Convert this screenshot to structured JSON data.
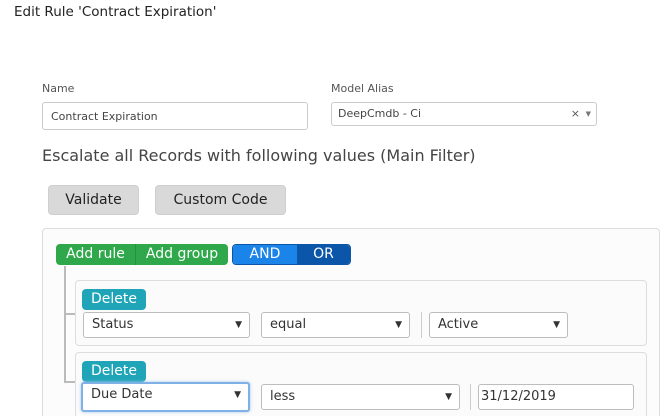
{
  "page": {
    "title": "Edit Rule 'Contract Expiration'"
  },
  "form": {
    "name_label": "Name",
    "name_value": "Contract Expiration",
    "alias_label": "Model Alias",
    "alias_value": "DeepCmdb - Ci",
    "alias_clear": "×",
    "alias_caret": "▼"
  },
  "filter": {
    "heading": "Escalate all Records with following values (Main Filter)",
    "validate_label": "Validate",
    "custom_code_label": "Custom Code"
  },
  "query_builder": {
    "add_rule_label": "Add rule",
    "add_group_label": "Add group",
    "and_label": "AND",
    "or_label": "OR",
    "active_condition": "AND",
    "rules": [
      {
        "delete_label": "Delete",
        "field": "Status",
        "operator": "equal",
        "value": "Active"
      },
      {
        "delete_label": "Delete",
        "field": "Due Date",
        "operator": "less",
        "value": "31/12/2019"
      }
    ],
    "dropdown_arrow": "▼"
  },
  "colors": {
    "green": "#2ea84a",
    "and_blue": "#1a84e8",
    "or_blue": "#0b56a8",
    "teal": "#1fa4b8"
  }
}
